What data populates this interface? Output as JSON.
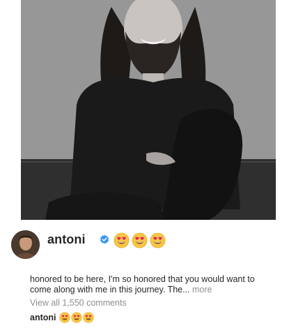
{
  "post": {
    "image_description_icon": "portrait-photo"
  },
  "comment": {
    "username": "antoni",
    "verified_icon": "verified-badge-icon",
    "emoji_icon": "heart-eyes-emoji",
    "accent_color": "#3897f0"
  },
  "caption": {
    "text": "honored to be here, I'm so honored that you would want to come along with me in this journey. The...",
    "more_label": "more"
  },
  "comments": {
    "view_all_label": "View all 1,550 comments"
  },
  "latest_comment": {
    "username": "antoni"
  }
}
